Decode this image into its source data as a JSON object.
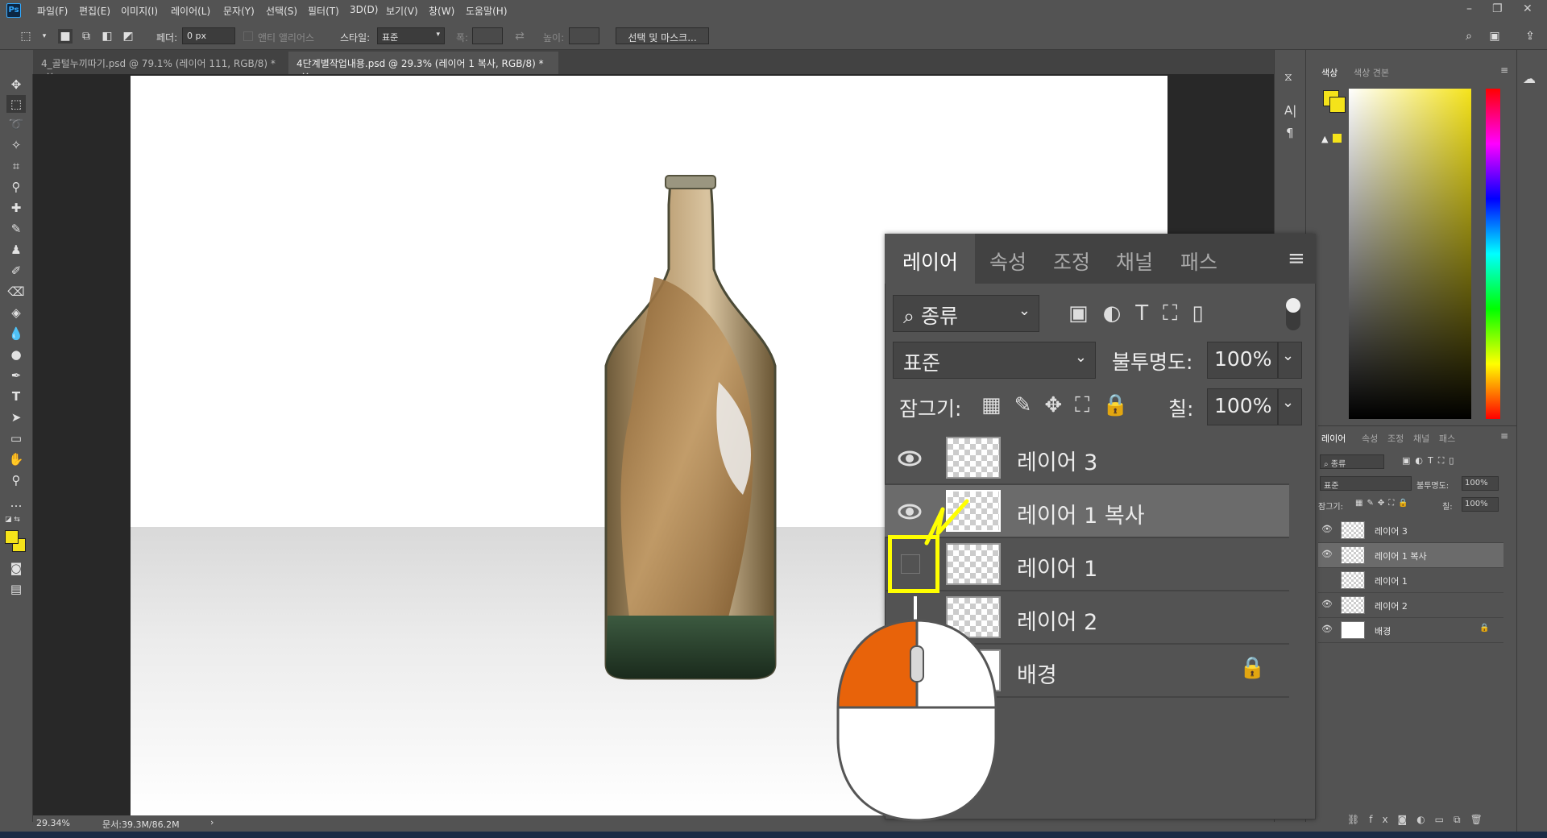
{
  "menubar": {
    "logo": "Ps",
    "items": [
      "파일(F)",
      "편집(E)",
      "이미지(I)",
      "레이어(L)",
      "문자(Y)",
      "선택(S)",
      "필터(T)",
      "3D(D)",
      "보기(V)",
      "창(W)",
      "도움말(H)"
    ]
  },
  "options": {
    "feather_label": "페더:",
    "feather_value": "0 px",
    "antialias_label": "앤티 앨리어스",
    "style_label": "스타일:",
    "style_value": "표준",
    "width_label": "폭:",
    "height_label": "높이:",
    "select_mask_button": "선택 및 마스크..."
  },
  "doc_tabs": [
    {
      "title": "4_골털누끼따기.psd @ 79.1% (레이어 111, RGB/8) *",
      "close": "×"
    },
    {
      "title": "4단계별작업내용.psd @ 29.3% (레이어 1 복사, RGB/8) *",
      "close": "×"
    }
  ],
  "status": {
    "zoom": "29.34%",
    "doc_info": "문서:39.3M/86.2M",
    "arrow": "›"
  },
  "color_panel": {
    "tabs": [
      "색상",
      "색상 견본"
    ],
    "foreground": "#f5e31a",
    "background": "#ffffff"
  },
  "small_layers_panel": {
    "tabs": [
      "레이어",
      "속성",
      "조정",
      "채널",
      "패스"
    ],
    "filter": "종류",
    "blend": "표준",
    "opacity_label": "불투명도:",
    "opacity_value": "100%",
    "lock_label": "잠그기:",
    "fill_label": "칠:",
    "fill_value": "100%",
    "layers": [
      {
        "name": "레이어 3",
        "visible": true,
        "selected": false
      },
      {
        "name": "레이어 1 복사",
        "visible": true,
        "selected": true
      },
      {
        "name": "레이어 1",
        "visible": false,
        "selected": false
      },
      {
        "name": "레이어 2",
        "visible": true,
        "selected": false
      },
      {
        "name": "배경",
        "visible": true,
        "selected": false,
        "locked": true
      }
    ]
  },
  "big_layers_panel": {
    "tabs": [
      "레이어",
      "속성",
      "조정",
      "채널",
      "패스"
    ],
    "filter": "종류",
    "blend": "표준",
    "opacity_label": "불투명도:",
    "opacity_value": "100%",
    "lock_label": "잠그기:",
    "fill_label": "칠:",
    "fill_value": "100%",
    "layers": [
      {
        "name": "레이어 3"
      },
      {
        "name": "레이어 1 복사"
      },
      {
        "name": "레이어 1"
      },
      {
        "name": "레이어 2"
      },
      {
        "name": "배경"
      }
    ]
  },
  "colors": {
    "accent_yellow": "#f5e31a",
    "mouse_orange": "#e8630a",
    "highlight": "#ffff00"
  }
}
